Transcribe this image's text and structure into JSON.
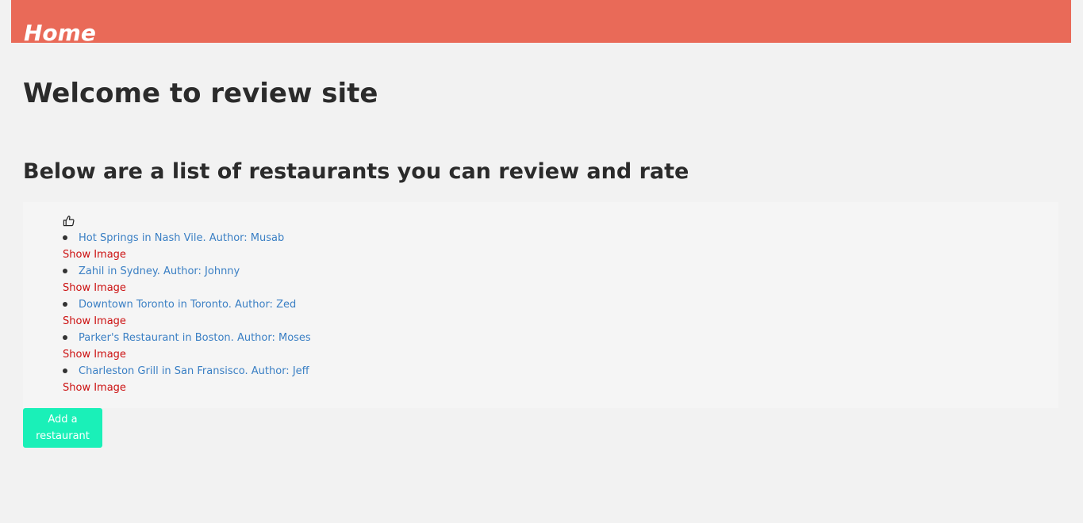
{
  "header": {
    "title": "Home",
    "bg_color": "#e96a58"
  },
  "main": {
    "welcome_title": "Welcome to review site",
    "list_title": "Below are a list of restaurants you can review and rate",
    "like_icon": "thumbs-up-icon",
    "restaurants": [
      {
        "label": "Hot Springs in Nash Vile. Author: Musab",
        "action": "Show Image"
      },
      {
        "label": "Zahil in Sydney. Author: Johnny",
        "action": "Show Image"
      },
      {
        "label": "Downtown Toronto in Toronto. Author: Zed",
        "action": "Show Image"
      },
      {
        "label": "Parker's Restaurant in Boston. Author: Moses",
        "action": "Show Image"
      },
      {
        "label": "Charleston Grill in San Fransisco. Author: Jeff",
        "action": "Show Image"
      }
    ],
    "add_button_label": "Add a restaurant"
  },
  "colors": {
    "link": "#3a7fc4",
    "show_image": "#cc1111",
    "button": "#1af0b8",
    "page_bg": "#f2f2f2"
  }
}
